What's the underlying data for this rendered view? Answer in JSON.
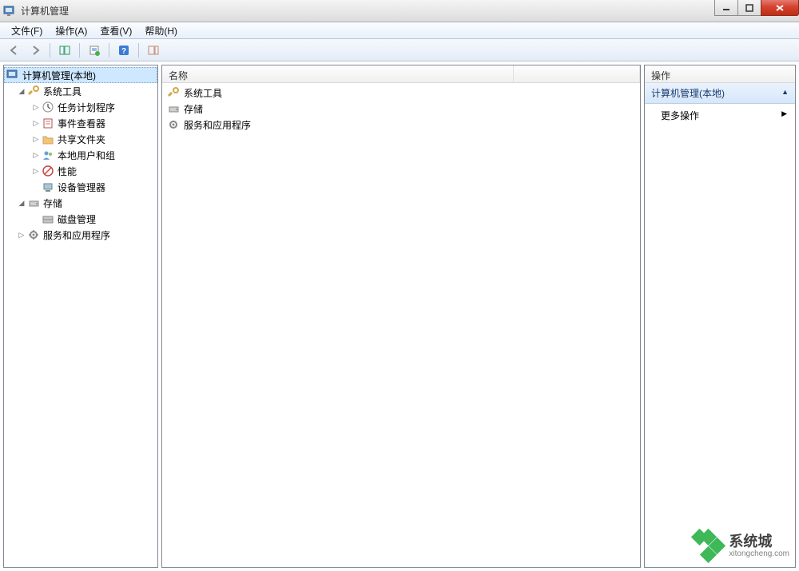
{
  "window": {
    "title": "计算机管理"
  },
  "menu": {
    "file": "文件(F)",
    "action": "操作(A)",
    "view": "查看(V)",
    "help": "帮助(H)"
  },
  "tree": {
    "root": "计算机管理(本地)",
    "systools": "系统工具",
    "scheduler": "任务计划程序",
    "eventviewer": "事件查看器",
    "sharedfolders": "共享文件夹",
    "localusers": "本地用户和组",
    "performance": "性能",
    "devicemgr": "设备管理器",
    "storage": "存储",
    "diskmgmt": "磁盘管理",
    "services": "服务和应用程序"
  },
  "list": {
    "header_name": "名称",
    "items": {
      "systools": "系统工具",
      "storage": "存储",
      "services": "服务和应用程序"
    }
  },
  "actions": {
    "header": "操作",
    "section": "计算机管理(本地)",
    "more": "更多操作"
  },
  "watermark": {
    "cn": "系统城",
    "en": "xitongcheng.com"
  }
}
